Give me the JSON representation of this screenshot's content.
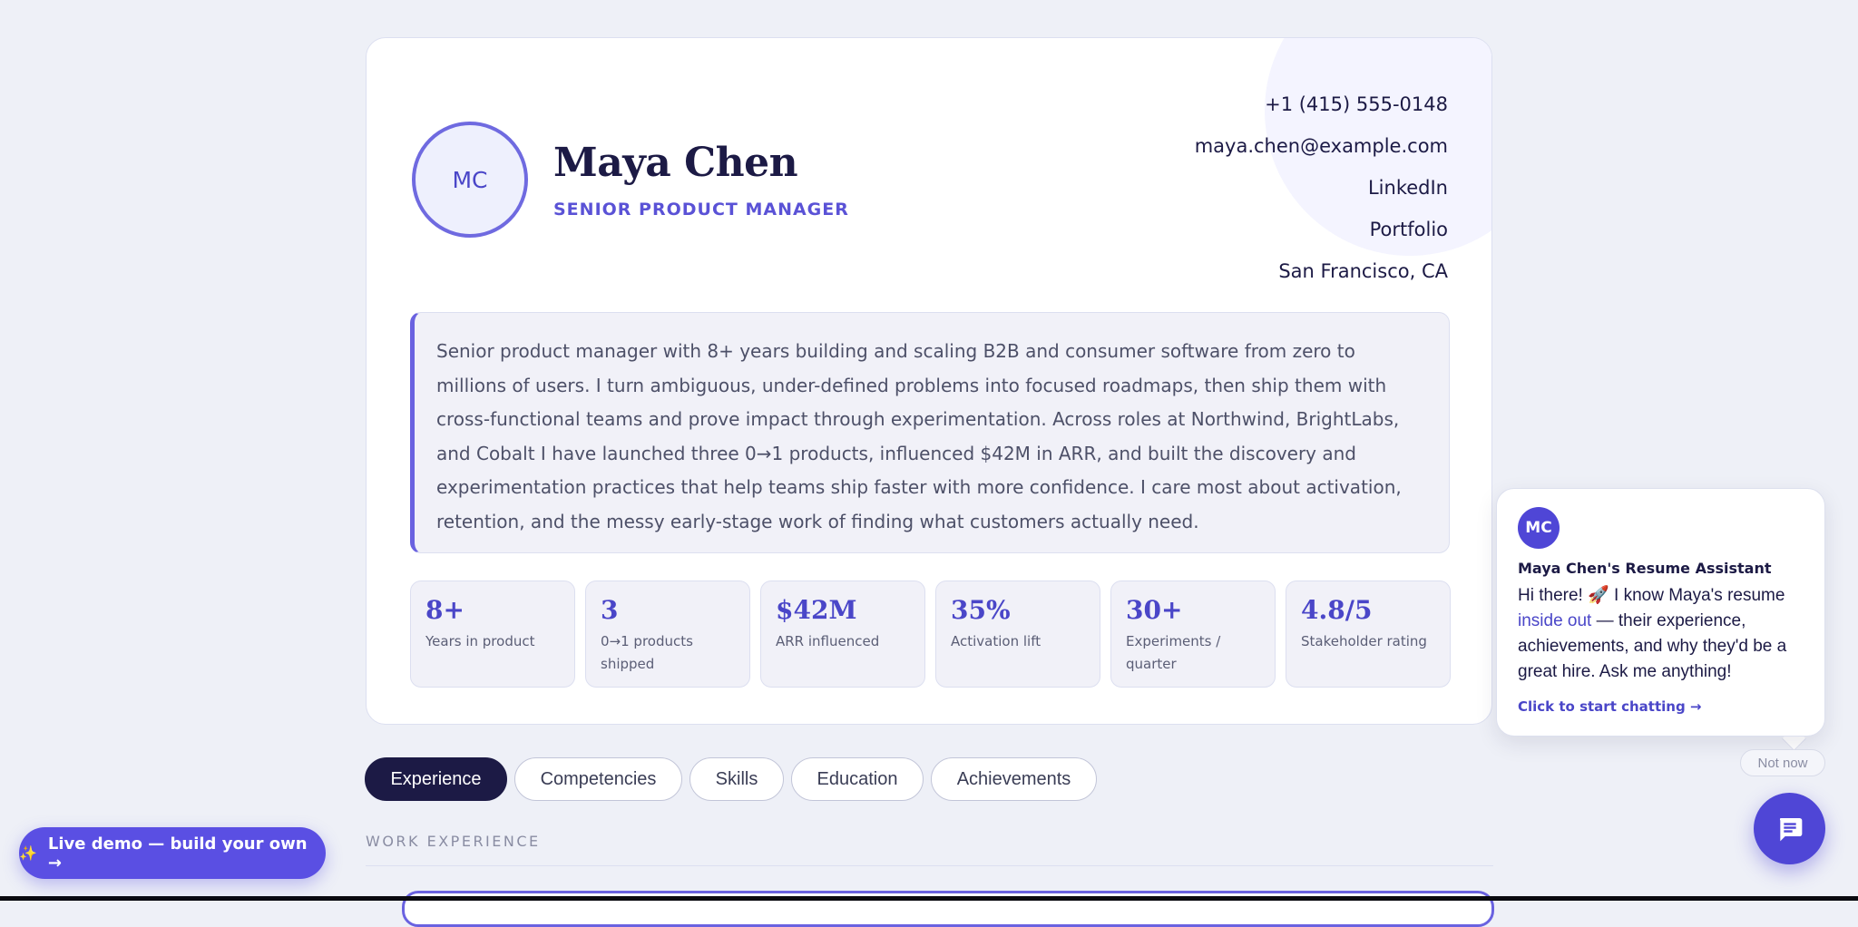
{
  "profile": {
    "initials": "MC",
    "name": "Maya Chen",
    "role": "SENIOR PRODUCT MANAGER"
  },
  "contact": {
    "phone": "+1 (415) 555-0148",
    "email": "maya.chen@example.com",
    "linkedin": "LinkedIn",
    "portfolio": "Portfolio",
    "location": "San Francisco, CA"
  },
  "summary": "Senior product manager with 8+ years building and scaling B2B and consumer software from zero to millions of users. I turn ambiguous, under-defined problems into focused roadmaps, then ship them with cross-functional teams and prove impact through experimentation. Across roles at Northwind, BrightLabs, and Cobalt I have launched three 0→1 products, influenced $42M in ARR, and built the discovery and experimentation practices that help teams ship faster with more confidence. I care most about activation, retention, and the messy early-stage work of finding what customers actually need.",
  "stats": [
    {
      "value": "8+",
      "label": "Years in product"
    },
    {
      "value": "3",
      "label": "0→1 products shipped"
    },
    {
      "value": "$42M",
      "label": "ARR influenced"
    },
    {
      "value": "35%",
      "label": "Activation lift"
    },
    {
      "value": "30+",
      "label": "Experiments / quarter"
    },
    {
      "value": "4.8/5",
      "label": "Stakeholder rating"
    }
  ],
  "tabs": [
    {
      "label": "Experience",
      "active": true
    },
    {
      "label": "Competencies",
      "active": false
    },
    {
      "label": "Skills",
      "active": false
    },
    {
      "label": "Education",
      "active": false
    },
    {
      "label": "Achievements",
      "active": false
    }
  ],
  "section": {
    "title": "WORK EXPERIENCE"
  },
  "demo_button": {
    "label": "Live demo — build your own →",
    "icon": "sparkles-icon"
  },
  "chat": {
    "avatar": "MC",
    "title": "Maya Chen's Resume Assistant",
    "message_before": "Hi there! 🚀 I know Maya's resume ",
    "message_accent": "inside out",
    "message_after": " — their experience, achievements, and why they'd be a great hire. Ask me anything!",
    "cta": "Click to start chatting →",
    "dismiss": "Not now",
    "fab_icon": "chat-icon"
  },
  "colors": {
    "accent": "#4f46d6",
    "navy": "#1c1a45",
    "background": "#eef0f7"
  }
}
